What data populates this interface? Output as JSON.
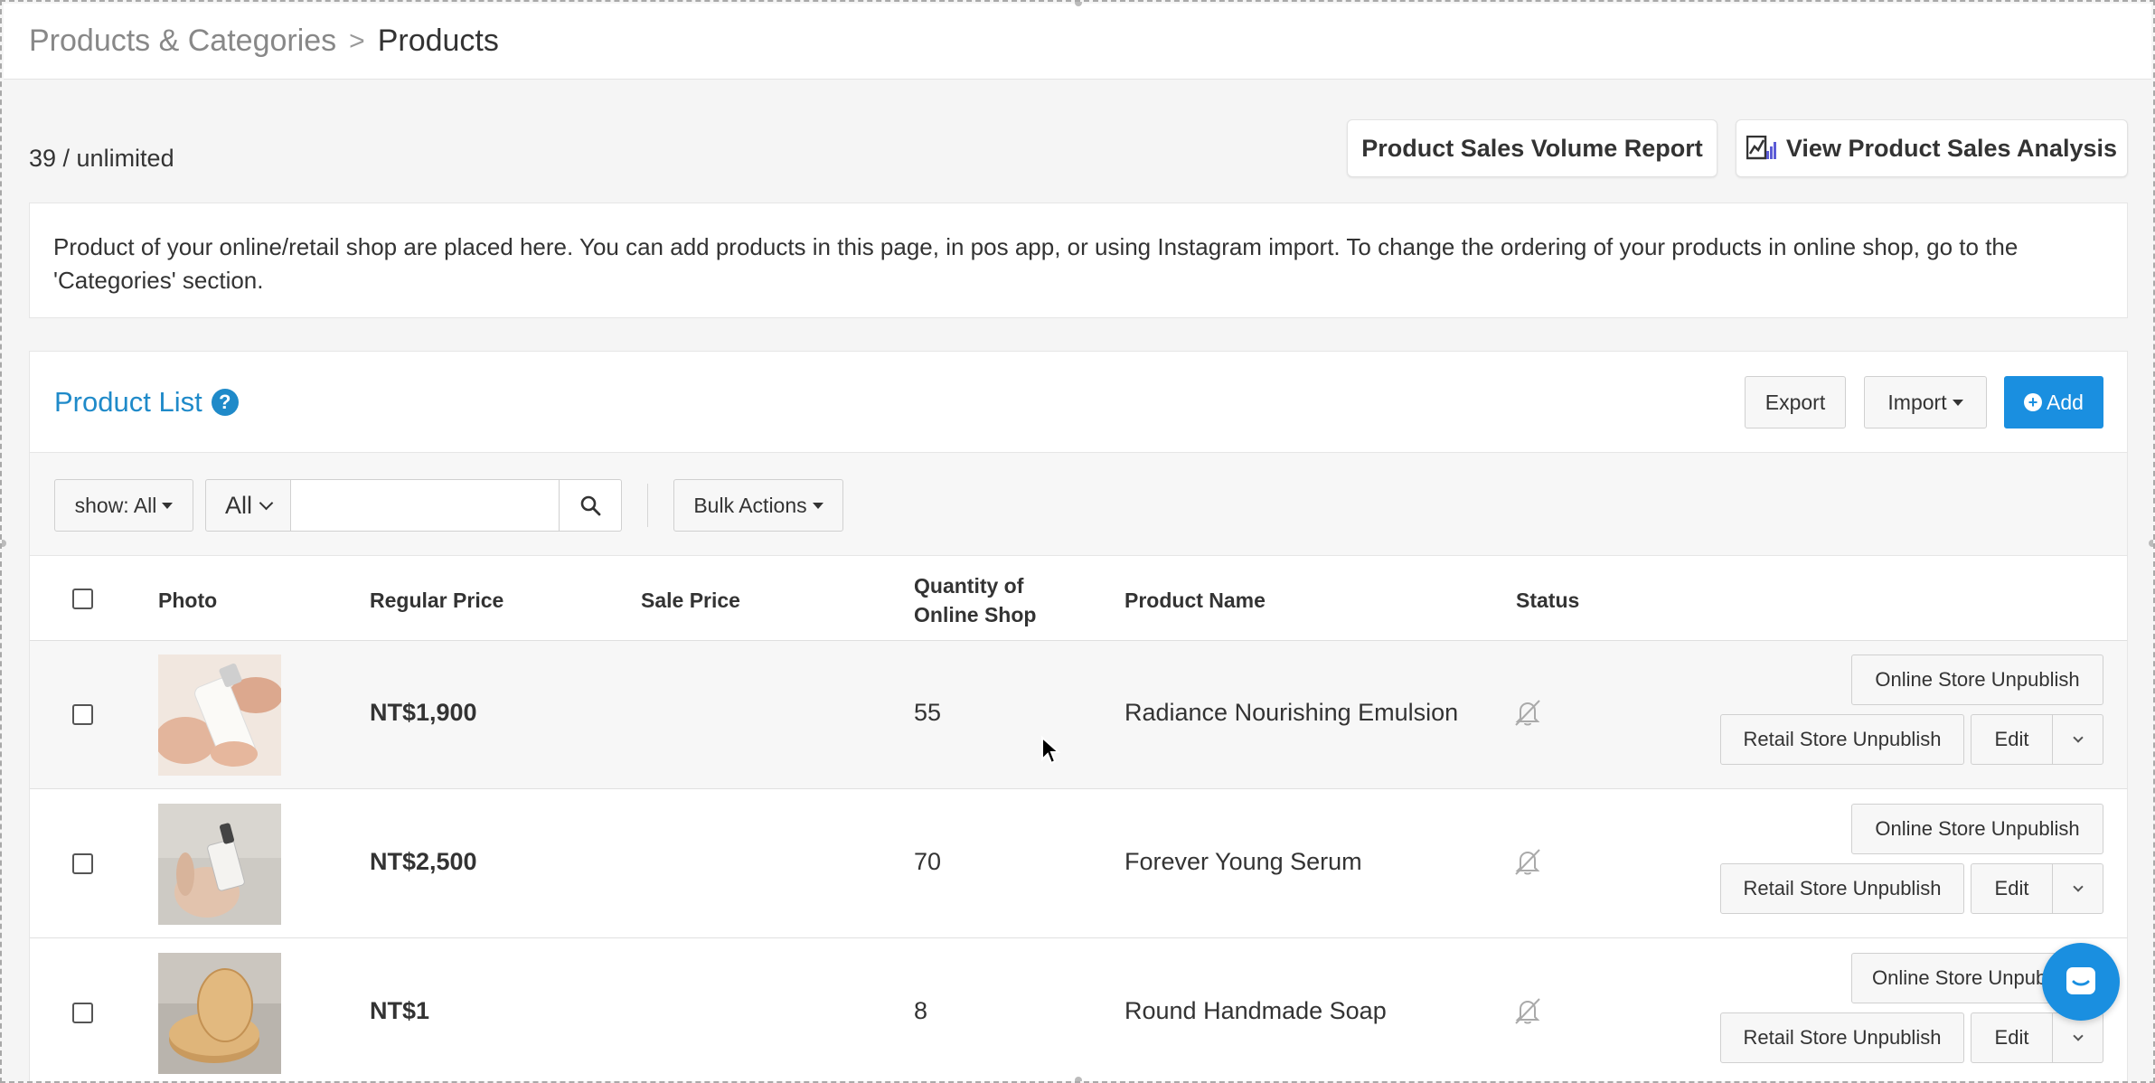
{
  "breadcrumb": {
    "parent": "Products & Categories",
    "separator": ">",
    "current": "Products"
  },
  "count_text": "39 / unlimited",
  "top_buttons": {
    "report": "Product Sales Volume Report",
    "analysis": "View Product Sales Analysis"
  },
  "info_text": "Product of your online/retail shop are placed here. You can add products in this page, in pos app, or using Instagram import. To change the ordering of your products in online shop, go to the 'Categories' section.",
  "panel": {
    "title": "Product List",
    "help_icon": "?",
    "export_label": "Export",
    "import_label": "Import",
    "add_label": "Add"
  },
  "toolbar": {
    "show_label": "show: All",
    "category_label": "All",
    "search_placeholder": "",
    "bulk_label": "Bulk Actions"
  },
  "table": {
    "headers": {
      "photo": "Photo",
      "regular_price": "Regular Price",
      "sale_price": "Sale Price",
      "quantity_line1": "Quantity of",
      "quantity_line2": "Online Shop",
      "product_name": "Product Name",
      "status": "Status"
    },
    "rows": [
      {
        "regular_price": "NT$1,900",
        "sale_price": "",
        "quantity": "55",
        "name": "Radiance Nourishing Emulsion",
        "status_icon": "bell-slash-icon",
        "online_action": "Online Store Unpublish",
        "retail_action": "Retail Store Unpublish",
        "edit_label": "Edit"
      },
      {
        "regular_price": "NT$2,500",
        "sale_price": "",
        "quantity": "70",
        "name": "Forever Young Serum",
        "status_icon": "bell-slash-icon",
        "online_action": "Online Store Unpublish",
        "retail_action": "Retail Store Unpublish",
        "edit_label": "Edit"
      },
      {
        "regular_price": "NT$1",
        "sale_price": "",
        "quantity": "8",
        "name": "Round Handmade Soap",
        "status_icon": "bell-slash-icon",
        "online_action": "Online Store Unpubl",
        "retail_action": "Retail Store Unpublish",
        "edit_label": "Edit"
      }
    ]
  },
  "colors": {
    "accent": "#1f8ac9",
    "primary_button": "#1a8fe0",
    "page_background": "#f5f5f5"
  }
}
